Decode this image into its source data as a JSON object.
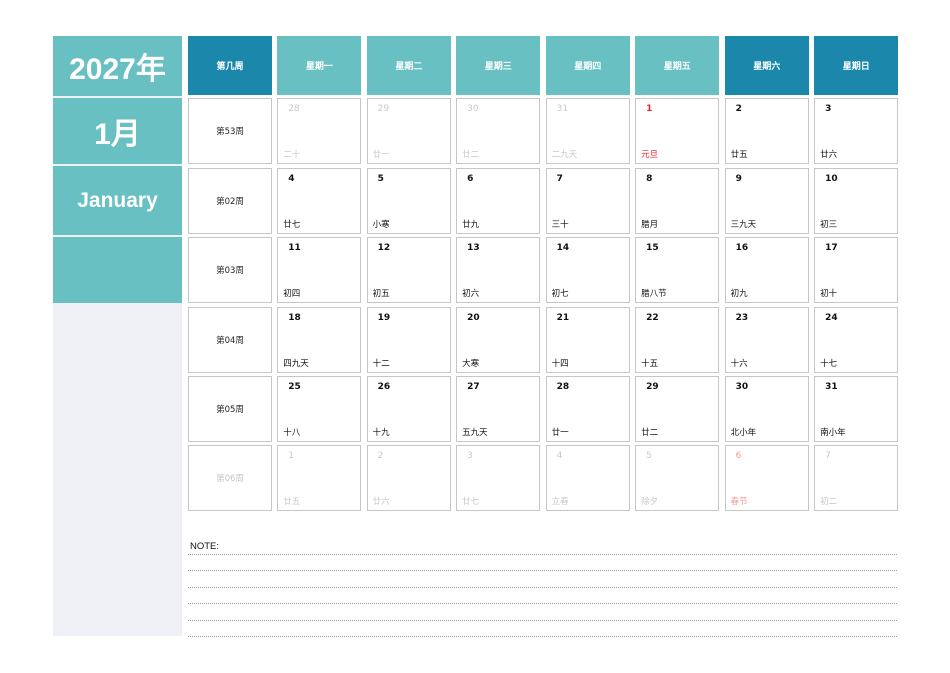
{
  "sidebar": {
    "year": "2027年",
    "month": "1月",
    "month_en": "January"
  },
  "headers": {
    "week": "第几周",
    "days": [
      {
        "label": "星期一",
        "style": "light"
      },
      {
        "label": "星期二",
        "style": "light"
      },
      {
        "label": "星期三",
        "style": "light"
      },
      {
        "label": "星期四",
        "style": "light"
      },
      {
        "label": "星期五",
        "style": "light"
      },
      {
        "label": "星期六",
        "style": "dark"
      },
      {
        "label": "星期日",
        "style": "dark"
      }
    ]
  },
  "weeks": [
    {
      "label": "第53周",
      "dim": false,
      "days": [
        {
          "num": "28",
          "lunar": "二十",
          "out": true
        },
        {
          "num": "29",
          "lunar": "廿一",
          "out": true
        },
        {
          "num": "30",
          "lunar": "廿二",
          "out": true
        },
        {
          "num": "31",
          "lunar": "二九天",
          "out": true
        },
        {
          "num": "1",
          "lunar": "元旦",
          "holiday": true
        },
        {
          "num": "2",
          "lunar": "廿五"
        },
        {
          "num": "3",
          "lunar": "廿六"
        }
      ]
    },
    {
      "label": "第02周",
      "dim": false,
      "days": [
        {
          "num": "4",
          "lunar": "廿七"
        },
        {
          "num": "5",
          "lunar": "小寒"
        },
        {
          "num": "6",
          "lunar": "廿九"
        },
        {
          "num": "7",
          "lunar": "三十"
        },
        {
          "num": "8",
          "lunar": "腊月"
        },
        {
          "num": "9",
          "lunar": "三九天"
        },
        {
          "num": "10",
          "lunar": "初三"
        }
      ]
    },
    {
      "label": "第03周",
      "dim": false,
      "days": [
        {
          "num": "11",
          "lunar": "初四"
        },
        {
          "num": "12",
          "lunar": "初五"
        },
        {
          "num": "13",
          "lunar": "初六"
        },
        {
          "num": "14",
          "lunar": "初七"
        },
        {
          "num": "15",
          "lunar": "腊八节"
        },
        {
          "num": "16",
          "lunar": "初九"
        },
        {
          "num": "17",
          "lunar": "初十"
        }
      ]
    },
    {
      "label": "第04周",
      "dim": false,
      "days": [
        {
          "num": "18",
          "lunar": "四九天"
        },
        {
          "num": "19",
          "lunar": "十二"
        },
        {
          "num": "20",
          "lunar": "大寒"
        },
        {
          "num": "21",
          "lunar": "十四"
        },
        {
          "num": "22",
          "lunar": "十五"
        },
        {
          "num": "23",
          "lunar": "十六"
        },
        {
          "num": "24",
          "lunar": "十七"
        }
      ]
    },
    {
      "label": "第05周",
      "dim": false,
      "days": [
        {
          "num": "25",
          "lunar": "十八"
        },
        {
          "num": "26",
          "lunar": "十九"
        },
        {
          "num": "27",
          "lunar": "五九天"
        },
        {
          "num": "28",
          "lunar": "廿一"
        },
        {
          "num": "29",
          "lunar": "廿二"
        },
        {
          "num": "30",
          "lunar": "北小年"
        },
        {
          "num": "31",
          "lunar": "南小年"
        }
      ]
    },
    {
      "label": "第06周",
      "dim": true,
      "days": [
        {
          "num": "1",
          "lunar": "廿五",
          "out": true
        },
        {
          "num": "2",
          "lunar": "廿六",
          "out": true
        },
        {
          "num": "3",
          "lunar": "廿七",
          "out": true
        },
        {
          "num": "4",
          "lunar": "立春",
          "out": true
        },
        {
          "num": "5",
          "lunar": "除夕",
          "out": true
        },
        {
          "num": "6",
          "lunar": "春节",
          "out": true,
          "holiday": true
        },
        {
          "num": "7",
          "lunar": "初二",
          "out": true
        }
      ]
    }
  ],
  "notes": {
    "label": "NOTE:",
    "line_count": 6
  },
  "colors": {
    "teal": "#68c0c2",
    "blue": "#1b87ab",
    "holiday_red": "#e0242c",
    "sidebar_bg": "#eff0f5"
  }
}
